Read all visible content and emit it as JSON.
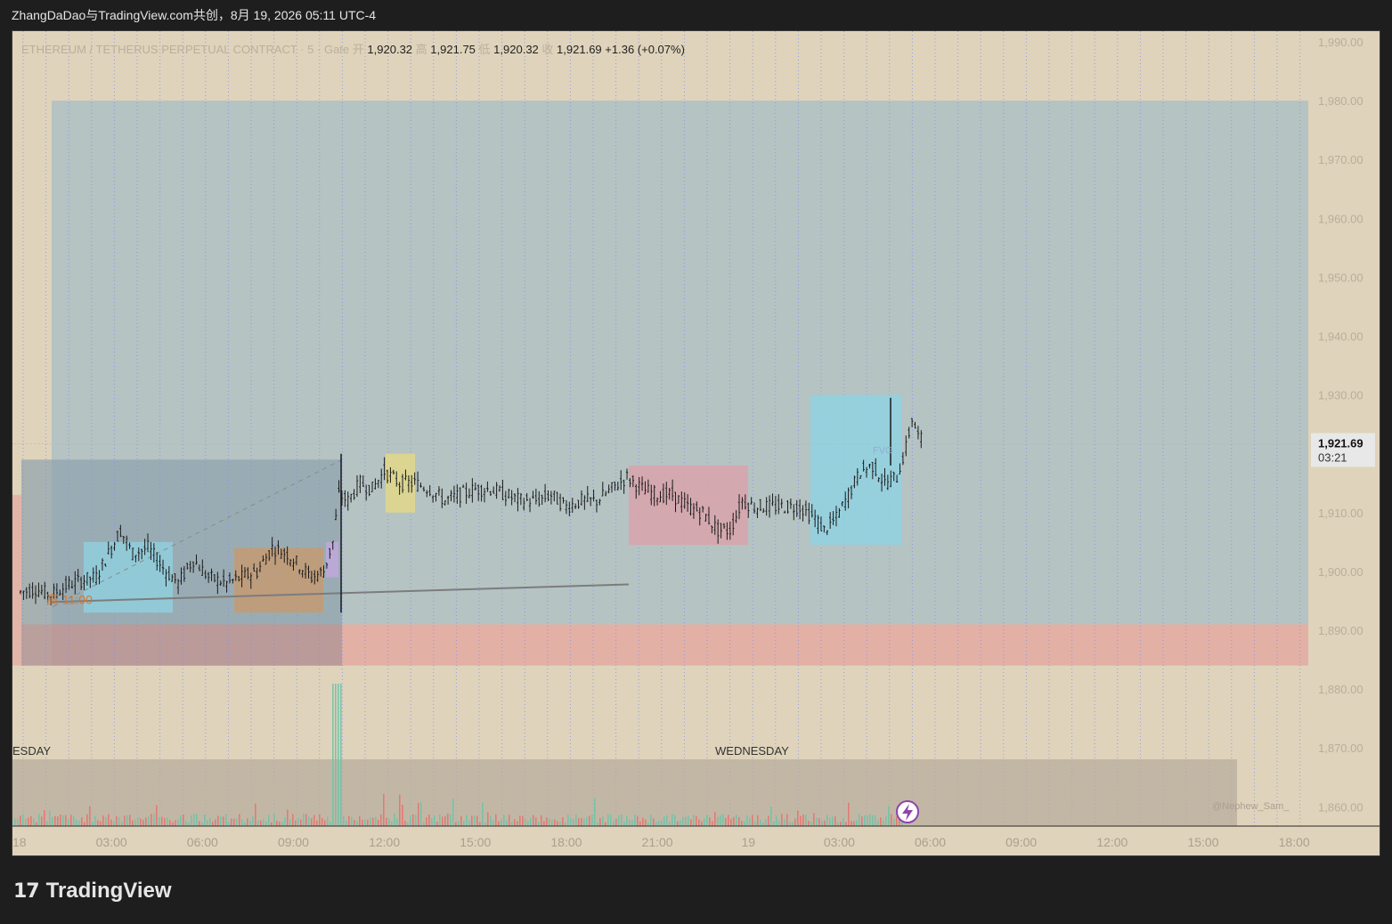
{
  "header": {
    "share_text": "ZhangDaDao与TradingView.com共创，8月 19, 2026 05:11 UTC-4"
  },
  "legend": {
    "symbol": "ETHEREUM / TETHERUS PERPETUAL CONTRACT · 5 · Gate",
    "open_label": "开",
    "open": "1,920.32",
    "high_label": "高",
    "high": "1,921.75",
    "low_label": "低",
    "low": "1,920.32",
    "close_label": "收",
    "close": "1,921.69",
    "change": "+1.36 (+0.07%)"
  },
  "price_tag": {
    "price": "1,921.69",
    "countdown": "03:21"
  },
  "day_labels": {
    "left": "ESDAY",
    "right": "WEDNESDAY"
  },
  "annotations": {
    "high_label": "高 11:00",
    "fvg_label": "FVG",
    "watermark": "@Nephew_Sam_"
  },
  "footer": {
    "brand": "TradingView",
    "logo_mark": "17"
  },
  "colors": {
    "background": "#dfd3bb",
    "candle": "#1a1a1a",
    "grid_vertical": "#7f8ff0",
    "zone_large": "#aebfc4",
    "zone_red": "#e4a8a0",
    "box_cyan": "#8fd3e3",
    "box_orange": "#c79a6e",
    "box_yellow": "#e3d88a",
    "box_pink": "#d9a3ab"
  },
  "chart_data": {
    "type": "candlestick",
    "symbol": "ETHEREUM / TETHERUS PERPETUAL CONTRACT",
    "timeframe": "5",
    "exchange": "Gate",
    "y_ticks": [
      1990,
      1980,
      1970,
      1960,
      1950,
      1940,
      1930,
      1920,
      1910,
      1900,
      1890,
      1880,
      1870,
      1860
    ],
    "y_tick_labels": [
      "1,990.00",
      "1,980.00",
      "1,970.00",
      "1,960.00",
      "1,950.00",
      "1,940.00",
      "1,930.00",
      "1,920.00",
      "1,910.00",
      "1,900.00",
      "1,890.00",
      "1,880.00",
      "1,870.00",
      "1,860.00"
    ],
    "ylim": [
      1857,
      1996
    ],
    "x_tick_labels": [
      "18",
      "03:00",
      "06:00",
      "09:00",
      "12:00",
      "15:00",
      "18:00",
      "21:00",
      "19",
      "03:00",
      "06:00",
      "09:00",
      "12:00",
      "15:00",
      "18:00"
    ],
    "x_ticks_hours": [
      0,
      3,
      6,
      9,
      12,
      15,
      18,
      21,
      24,
      27,
      30,
      33,
      36,
      39,
      42
    ],
    "xlim_hours": [
      0,
      42.5
    ],
    "last_price": 1921.69,
    "price_path": [
      [
        0,
        1896.5
      ],
      [
        0.5,
        1897
      ],
      [
        1.0,
        1896
      ],
      [
        1.5,
        1897.5
      ],
      [
        2.0,
        1898.5
      ],
      [
        2.5,
        1899
      ],
      [
        3.0,
        1904
      ],
      [
        3.3,
        1907
      ],
      [
        3.7,
        1903
      ],
      [
        4.2,
        1904
      ],
      [
        4.8,
        1900
      ],
      [
        5.2,
        1898
      ],
      [
        5.7,
        1902
      ],
      [
        6.2,
        1899
      ],
      [
        6.8,
        1898
      ],
      [
        7.3,
        1899
      ],
      [
        7.8,
        1900
      ],
      [
        8.3,
        1904
      ],
      [
        8.8,
        1903
      ],
      [
        9.2,
        1901
      ],
      [
        9.6,
        1899
      ],
      [
        10.0,
        1900
      ],
      [
        10.3,
        1905
      ],
      [
        10.5,
        1913
      ],
      [
        10.8,
        1912
      ],
      [
        11.2,
        1915
      ],
      [
        11.6,
        1914
      ],
      [
        12.0,
        1917
      ],
      [
        12.5,
        1915
      ],
      [
        13.0,
        1915
      ],
      [
        13.5,
        1914
      ],
      [
        14.0,
        1912
      ],
      [
        14.5,
        1913
      ],
      [
        15.0,
        1914
      ],
      [
        15.5,
        1914
      ],
      [
        16.0,
        1913
      ],
      [
        16.5,
        1912
      ],
      [
        17.0,
        1912
      ],
      [
        17.5,
        1913
      ],
      [
        18.0,
        1911
      ],
      [
        18.5,
        1912
      ],
      [
        19.0,
        1912
      ],
      [
        19.5,
        1914
      ],
      [
        20.0,
        1916
      ],
      [
        20.5,
        1914
      ],
      [
        21.0,
        1913
      ],
      [
        21.5,
        1913
      ],
      [
        22.0,
        1911
      ],
      [
        22.5,
        1910
      ],
      [
        23.0,
        1907
      ],
      [
        23.4,
        1907
      ],
      [
        23.8,
        1912
      ],
      [
        24.2,
        1911
      ],
      [
        24.7,
        1911
      ],
      [
        25.2,
        1911
      ],
      [
        25.7,
        1911
      ],
      [
        26.2,
        1909
      ],
      [
        26.5,
        1907
      ],
      [
        26.9,
        1909
      ],
      [
        27.3,
        1913
      ],
      [
        27.7,
        1917
      ],
      [
        28.1,
        1918
      ],
      [
        28.5,
        1915
      ],
      [
        28.9,
        1916
      ],
      [
        29.2,
        1921
      ],
      [
        29.4,
        1926
      ],
      [
        29.6,
        1923
      ],
      [
        29.8,
        1921.69
      ]
    ],
    "volume_spike_hours": [
      10.4,
      29.3
    ]
  }
}
